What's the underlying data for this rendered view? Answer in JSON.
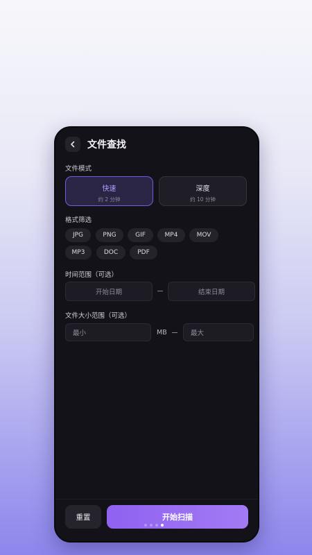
{
  "header": {
    "title": "文件查找"
  },
  "scan_mode": {
    "label": "文件模式",
    "options": [
      {
        "name": "快速",
        "time": "约 2 分钟",
        "selected": true
      },
      {
        "name": "深度",
        "time": "约 10 分钟",
        "selected": false
      }
    ]
  },
  "format_filter": {
    "label": "格式筛选",
    "formats": [
      "JPG",
      "PNG",
      "GIF",
      "MP4",
      "MOV",
      "MP3",
      "DOC",
      "PDF"
    ]
  },
  "time_range": {
    "label": "时间范围（可选）",
    "start_placeholder": "开始日期",
    "end_placeholder": "结束日期"
  },
  "size_range": {
    "label": "文件大小范围（可选）",
    "min_placeholder": "最小",
    "unit": "MB",
    "max_placeholder": "最大"
  },
  "actions": {
    "reset_label": "重置",
    "start_label": "开始扫描"
  },
  "pager": {
    "total": 4,
    "active_index": 3
  },
  "colors": {
    "accent": "#8f62f0",
    "background": "#131218"
  }
}
